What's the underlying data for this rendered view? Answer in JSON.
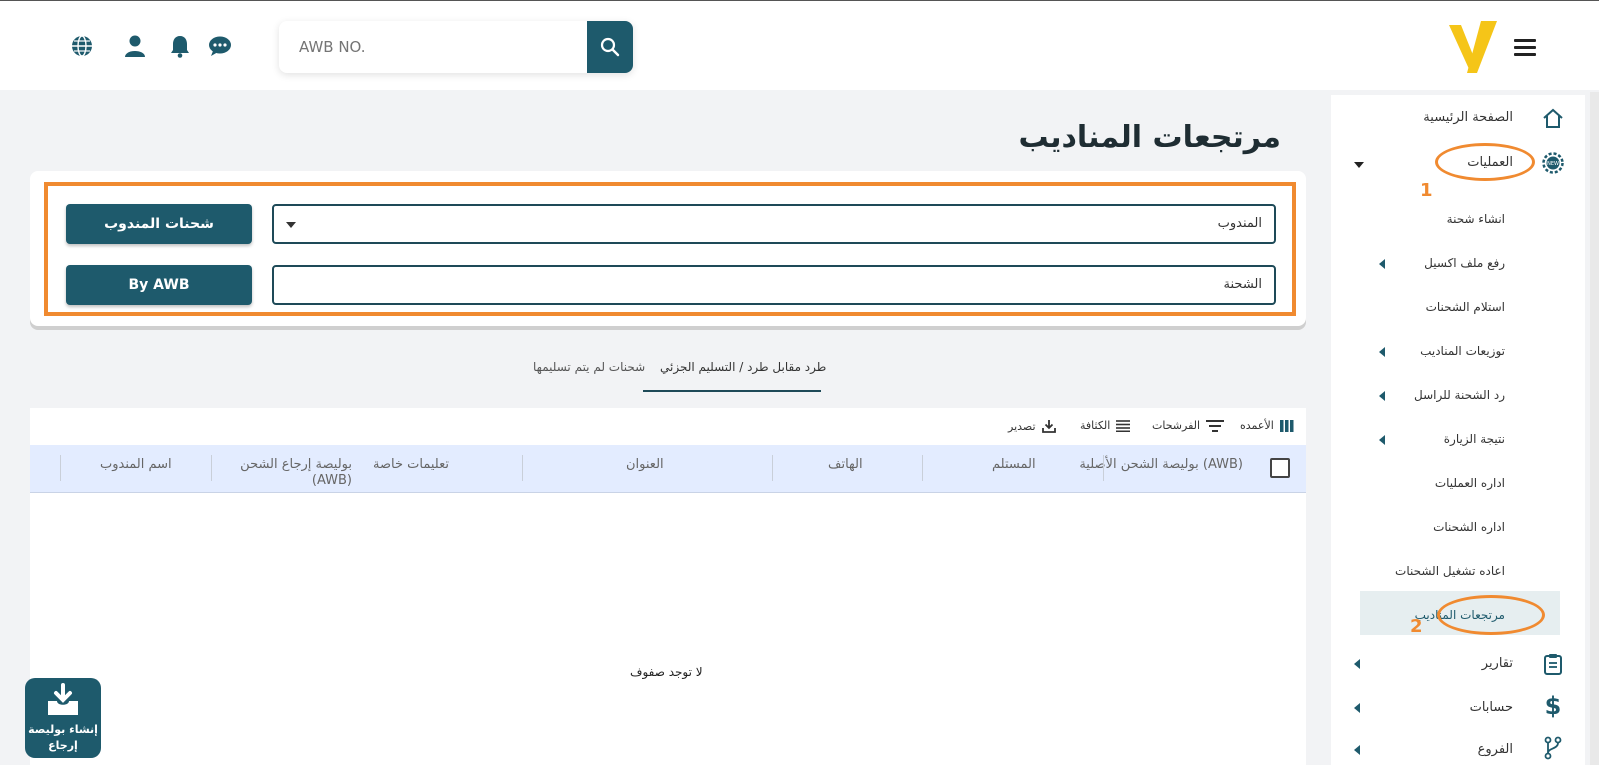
{
  "header": {
    "search_placeholder": "AWB NO."
  },
  "icons": {
    "menu": "hamburger-icon",
    "search": "search-icon",
    "globe": "globe-icon",
    "user": "user-icon",
    "bell": "bell-icon",
    "chat": "chat-icon"
  },
  "sidebar": {
    "items": [
      {
        "label": "الصفحة الرئيسية",
        "icon": "home-icon"
      },
      {
        "label": "العمليات",
        "icon": "gear-new-icon",
        "expanded": true
      },
      {
        "label": "انشاء شحنة"
      },
      {
        "label": "رفع ملف اكسيل",
        "has_arrow": true
      },
      {
        "label": "استلام الشحنات"
      },
      {
        "label": "توزيعات المناديب",
        "has_arrow": true
      },
      {
        "label": "رد الشحنة للراسل",
        "has_arrow": true
      },
      {
        "label": "نتيجة الزيارة",
        "has_arrow": true
      },
      {
        "label": "اداره العمليات"
      },
      {
        "label": "اداره الشحنات"
      },
      {
        "label": "اعاده تشغيل الشحنات"
      },
      {
        "label": "مرتجعات المناديب",
        "active": true
      },
      {
        "label": "تقارير",
        "icon": "clipboard-icon",
        "has_arrow": true
      },
      {
        "label": "حسابات",
        "icon": "dollar-icon",
        "has_arrow": true
      },
      {
        "label": "الفروع",
        "icon": "branch-icon",
        "has_arrow": true
      }
    ]
  },
  "page": {
    "title": "مرتجعات المناديب"
  },
  "filters": {
    "courier_label": "المندوب",
    "shipment_label": "الشحنة",
    "courier_shipments_button": "شحنات المندوب",
    "by_awb_button": "By AWB"
  },
  "tabs": [
    {
      "label": "طرد مقابل طرد / التسليم الجزئي",
      "active": true
    },
    {
      "label": "شحنات لم يتم تسليمها",
      "active": false
    }
  ],
  "toolbar": {
    "columns": "الأعمده",
    "filters": "الفرشحات",
    "density": "الكثافة",
    "export": "تصدير"
  },
  "table": {
    "columns": [
      "بوليصة الشحن الأصلية (AWB)",
      "المستلم",
      "الهاتف",
      "العنوان",
      "تعليمات خاصة",
      "بوليصة إرجاع الشحن (AWB)",
      "اسم المندوب"
    ],
    "empty_text": "لا توجد صفوف"
  },
  "annotations": {
    "callout_1": "1",
    "callout_2": "2"
  },
  "fab": {
    "label": "إنشاء بوليصة إرجاع"
  },
  "colors": {
    "primary": "#1e5a6c",
    "accent": "#f08a30",
    "logo": "#f5c518",
    "table_header": "#e3ecff"
  }
}
